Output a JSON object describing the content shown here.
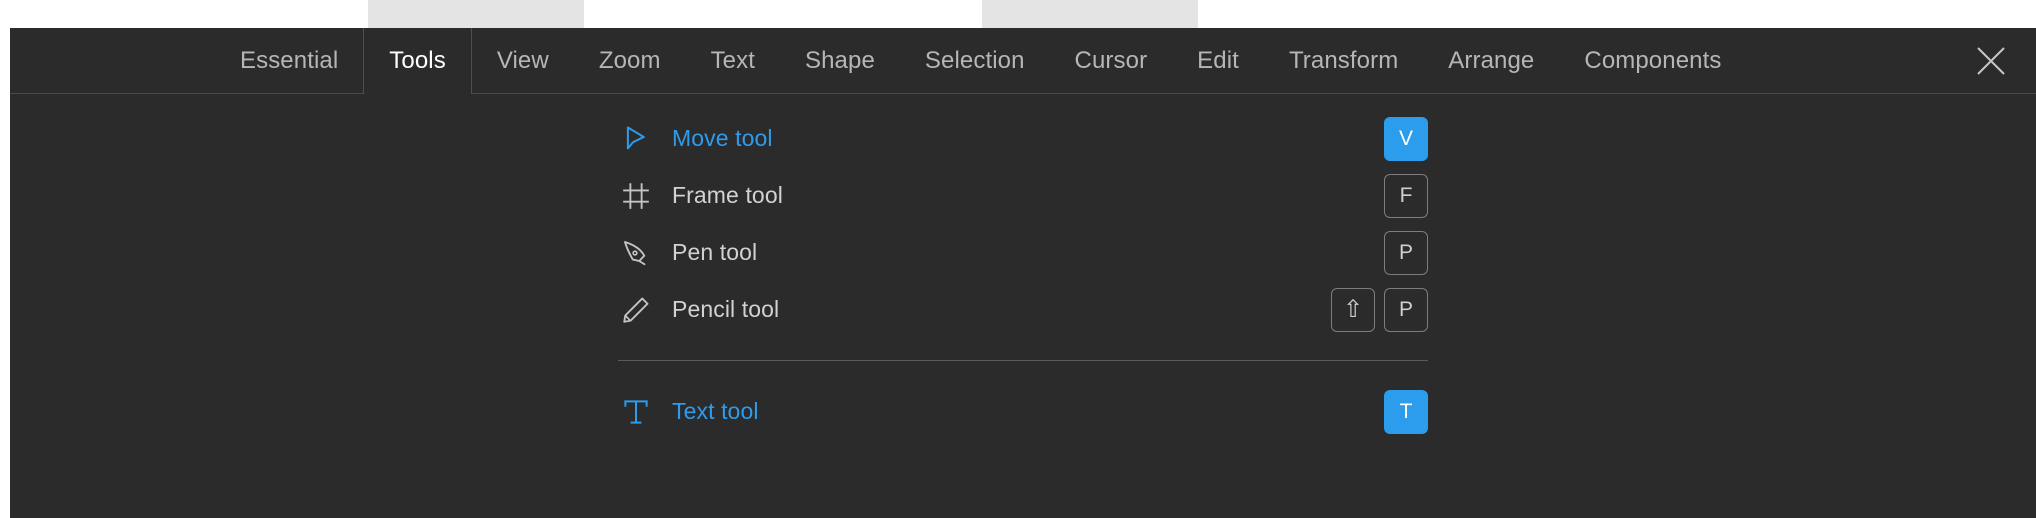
{
  "window": {
    "background_color": "#ffffff",
    "panel_color": "#2b2b2b",
    "accent_color": "#2c9ced",
    "muted_text_color": "#b6b6b6",
    "active_text_color": "#ffffff"
  },
  "tabs": [
    {
      "label": "Essential",
      "active": false
    },
    {
      "label": "Tools",
      "active": true
    },
    {
      "label": "View",
      "active": false
    },
    {
      "label": "Zoom",
      "active": false
    },
    {
      "label": "Text",
      "active": false
    },
    {
      "label": "Shape",
      "active": false
    },
    {
      "label": "Selection",
      "active": false
    },
    {
      "label": "Cursor",
      "active": false
    },
    {
      "label": "Edit",
      "active": false
    },
    {
      "label": "Transform",
      "active": false
    },
    {
      "label": "Arrange",
      "active": false
    },
    {
      "label": "Components",
      "active": false
    }
  ],
  "close_button": {
    "icon": "close-icon"
  },
  "tools": [
    {
      "label": "Move tool",
      "icon": "cursor-arrow-icon",
      "active": true,
      "keys": [
        {
          "label": "V",
          "accent": true
        }
      ]
    },
    {
      "label": "Frame tool",
      "icon": "frame-icon",
      "active": false,
      "keys": [
        {
          "label": "F",
          "accent": false
        }
      ]
    },
    {
      "label": "Pen tool",
      "icon": "pen-nib-icon",
      "active": false,
      "keys": [
        {
          "label": "P",
          "accent": false
        }
      ]
    },
    {
      "label": "Pencil tool",
      "icon": "pencil-icon",
      "active": false,
      "keys": [
        {
          "label": "⇧",
          "accent": false,
          "glyph": "shift"
        },
        {
          "label": "P",
          "accent": false
        }
      ]
    }
  ],
  "tools_after_divider": [
    {
      "label": "Text tool",
      "icon": "text-icon",
      "active": true,
      "keys": [
        {
          "label": "T",
          "accent": true
        }
      ]
    }
  ]
}
